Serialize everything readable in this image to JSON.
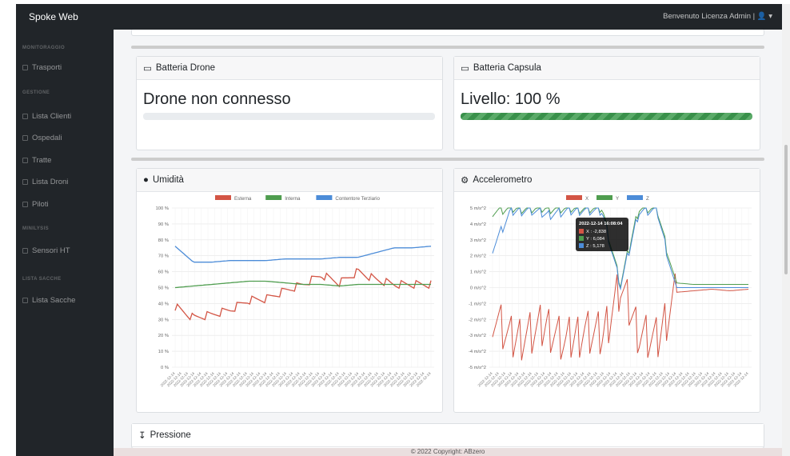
{
  "topbar": {
    "brand": "Spoke Web",
    "user_text": "Benvenuto Licenza Admin | ",
    "user_icon": "user-icon"
  },
  "sidebar": {
    "sections": [
      {
        "title": "MONITORAGGIO",
        "items": [
          {
            "label": "Trasporti",
            "icon": "chart-icon"
          }
        ]
      },
      {
        "title": "GESTIONE",
        "items": [
          {
            "label": "Lista Clienti",
            "icon": "table-icon"
          },
          {
            "label": "Ospedali",
            "icon": "table-icon"
          },
          {
            "label": "Tratte",
            "icon": "table-icon"
          },
          {
            "label": "Lista Droni",
            "icon": "table-icon"
          },
          {
            "label": "Piloti",
            "icon": "table-icon"
          }
        ]
      },
      {
        "title": "MINILYSIS",
        "items": [
          {
            "label": "Sensori HT",
            "icon": "table-icon"
          }
        ]
      },
      {
        "title": "LISTA SACCHE",
        "items": [
          {
            "label": "Lista Sacche",
            "icon": "table-icon"
          }
        ]
      }
    ]
  },
  "cards": {
    "battery_drone": {
      "title": "Batteria Drone",
      "icon": "battery-icon",
      "status": "Drone non connesso",
      "level": 0
    },
    "battery_capsule": {
      "title": "Batteria Capsula",
      "icon": "battery-icon",
      "status": "Livello: 100 %",
      "level": 100
    },
    "humidity": {
      "title": "Umidità",
      "icon": "droplet-icon"
    },
    "accelerometer": {
      "title": "Accelerometro",
      "icon": "gear-icon"
    },
    "pressure": {
      "title": "Pressione",
      "icon": "chevron-down-icon"
    }
  },
  "footer": {
    "text": "© 2022 Copyright: ABzero"
  },
  "chart_data": [
    {
      "type": "line",
      "title": "",
      "xlabel": "",
      "ylabel": "",
      "ylim": [
        0,
        100
      ],
      "y_ticks": [
        "100 %",
        "90 %",
        "80 %",
        "70 %",
        "60 %",
        "50 %",
        "40 %",
        "30 %",
        "20 %",
        "10 %",
        "0 %"
      ],
      "x_tick_label": "2022-12-14",
      "legend_position": "top",
      "series": [
        {
          "name": "Esterna",
          "color": "#d35545",
          "values": [
            38,
            31,
            33,
            36,
            42,
            43,
            48,
            52,
            58,
            53,
            60,
            55,
            52,
            52,
            52
          ]
        },
        {
          "name": "Interna",
          "color": "#4f9d4f",
          "values": [
            50,
            51,
            52,
            53,
            54,
            54,
            53,
            52,
            52,
            51,
            52,
            52,
            52,
            52,
            52
          ]
        },
        {
          "name": "Contentore Terziario",
          "color": "#4c8cd8",
          "values": [
            76,
            66,
            66,
            67,
            67,
            67,
            68,
            68,
            68,
            69,
            69,
            72,
            75,
            75,
            76
          ]
        }
      ]
    },
    {
      "type": "line",
      "title": "",
      "xlabel": "",
      "ylabel": "",
      "ylim": [
        -5,
        5
      ],
      "y_ticks": [
        "5 m/s^2",
        "4 m/s^2",
        "3 m/s^2",
        "2 m/s^2",
        "1 m/s^2",
        "0 m/s^2",
        "-1 m/s^2",
        "-2 m/s^2",
        "-3 m/s^2",
        "-4 m/s^2",
        "-5 m/s^2"
      ],
      "x_tick_label": "2022-12-14",
      "legend_position": "top",
      "series": [
        {
          "name": "X",
          "color": "#d35545",
          "values": [
            -1.5,
            -3.2,
            -2.8,
            -2.3,
            -3.4,
            -2.6,
            -3.0,
            0.2,
            -2.7,
            -3.3,
            -0.3,
            -0.2,
            -0.1,
            -0.2,
            -0.1
          ]
        },
        {
          "name": "Y",
          "color": "#4f9d4f",
          "values": [
            4.8,
            5.0,
            5.0,
            5.0,
            5.0,
            5.0,
            5.0,
            0.2,
            5.0,
            5.0,
            0.3,
            0.2,
            0.2,
            0.2,
            0.2
          ]
        },
        {
          "name": "Z",
          "color": "#4c8cd8",
          "values": [
            2.5,
            4.8,
            4.9,
            4.6,
            4.8,
            4.9,
            4.8,
            0.1,
            4.8,
            4.9,
            0.0,
            0.0,
            0.0,
            0.0,
            0.0
          ]
        }
      ],
      "tooltip": {
        "title": "2022-12-14 16:08:04",
        "rows": [
          "X : -2,838",
          "Y : 6,084",
          "Z : 5,178"
        ]
      }
    }
  ]
}
